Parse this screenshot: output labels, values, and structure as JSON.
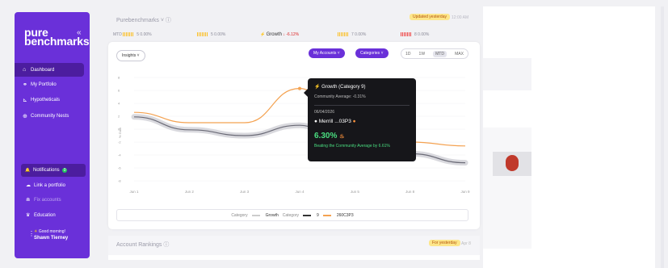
{
  "sidebar": {
    "brand_line1": "pure",
    "brand_line2": "benchmarks",
    "collapse": "«",
    "items": [
      {
        "label": "Dashboard",
        "icon": "⌂",
        "icon_name": "home-icon"
      },
      {
        "label": "My Portfolio",
        "icon": "⚭",
        "icon_name": "users-icon"
      },
      {
        "label": "Hypotheticals",
        "icon": "⊾",
        "icon_name": "chart-icon"
      },
      {
        "label": "Community Nests",
        "icon": "⊕",
        "icon_name": "globe-icon"
      }
    ],
    "notifications": {
      "label": "Notifications",
      "count": "0",
      "icon": "🔔"
    },
    "link_portfolio": "Link a portfolio",
    "fix_accounts": "Fix accounts",
    "education": "Education",
    "greeting": "Good morning!",
    "user_name": "Shawn Tierney"
  },
  "top": {
    "title": "Purebenchmarks",
    "updated_badge": "Updated yesterday",
    "updated_time": "12:00 AM"
  },
  "stats": [
    {
      "count": "5",
      "value": "0.00%"
    },
    {
      "count": "5",
      "value": "0.00%"
    },
    {
      "label": "Growth",
      "value": "-6.12%"
    },
    {
      "count": "7",
      "value": "0.00%"
    },
    {
      "count": "8",
      "value": "0.00%"
    }
  ],
  "controls": {
    "insights": "Insights",
    "my_accounts": "My Accounts",
    "categories": "Categories",
    "ranges": [
      "1D",
      "1W",
      "MTD",
      "MAX"
    ],
    "selected_range": "MTD"
  },
  "tooltip": {
    "title": "Growth (Category 9)",
    "community_avg": "Community Average: -0.31%",
    "date": "06/04/2026",
    "account": "Merrill ...03P3",
    "percent": "6.30%",
    "beat": "Beating the Community Average by 6.61%"
  },
  "legend": {
    "cat_label1": "Category",
    "growth": "Growth",
    "cat_label2": "Category",
    "nine": "9",
    "acct": "260C3P3"
  },
  "rankings": {
    "title": "Account Rankings",
    "badge": "For yesterday",
    "time": "Apr 8"
  },
  "colors": {
    "accent": "#6a30d9",
    "orange": "#f4a251",
    "gray": "#6b6b77",
    "positive": "#4ade80"
  },
  "chart_data": {
    "type": "line",
    "ylabel": "% Gain",
    "x": [
      "Jun 1",
      "Jun 2",
      "Jun 3",
      "Jun 4",
      "Jun 5",
      "Jun 8",
      "Jun 9"
    ],
    "ytick_labels": [
      "8",
      "6",
      "4",
      "2",
      "0",
      "-2",
      "-4",
      "-6",
      "-8"
    ],
    "ylim": [
      -8,
      8
    ],
    "series": [
      {
        "name": "260C3P3",
        "color": "#f4a251",
        "values": [
          2.6,
          1.0,
          1.0,
          6.3,
          -1.8,
          -2.0,
          -2.6
        ]
      },
      {
        "name": "9",
        "color": "#6b6b77",
        "values": [
          1.9,
          -0.1,
          -1.0,
          0.6,
          -3.8,
          -3.8,
          -5.2
        ]
      }
    ]
  }
}
